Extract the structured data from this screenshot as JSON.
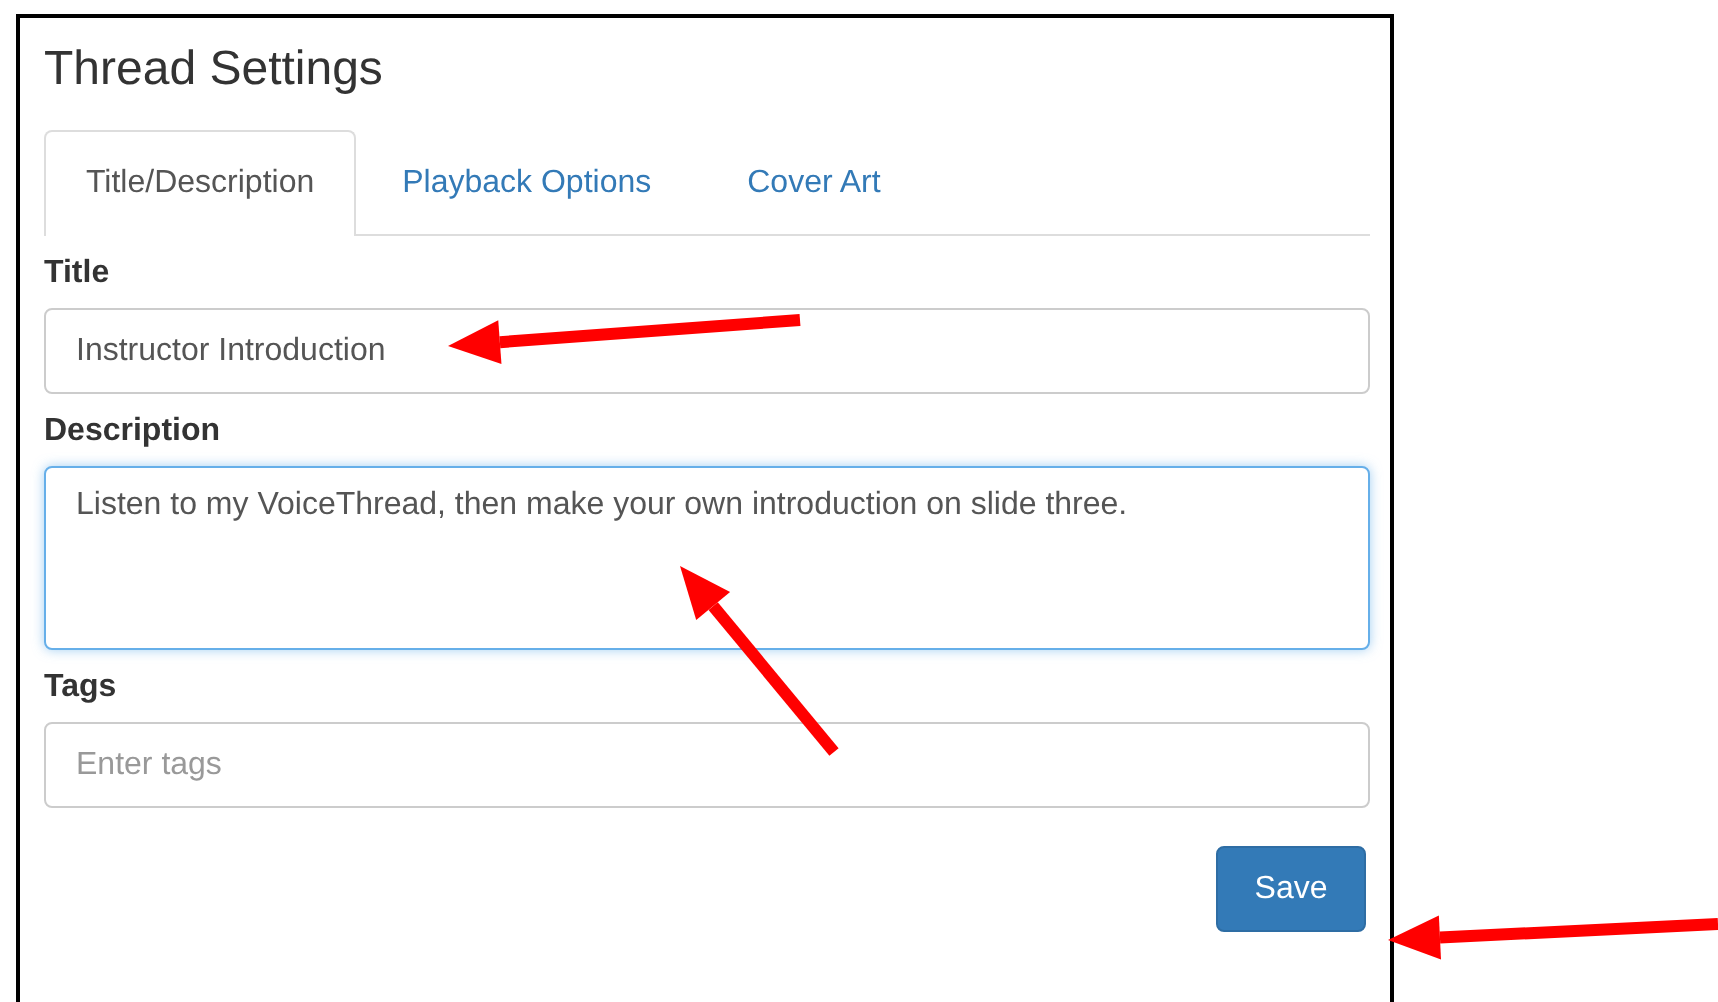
{
  "heading": "Thread Settings",
  "tabs": [
    {
      "label": "Title/Description",
      "selected": true
    },
    {
      "label": "Playback Options",
      "selected": false
    },
    {
      "label": "Cover Art",
      "selected": false
    }
  ],
  "fields": [
    {
      "kind": "input",
      "label": "Title",
      "value": "Instructor Introduction",
      "focused": false
    },
    {
      "kind": "textarea",
      "label": "Description",
      "value": "Listen to my VoiceThread, then make your own introduction on slide three.",
      "focused": true
    },
    {
      "kind": "input",
      "label": "Tags",
      "placeholder": "Enter tags",
      "focused": false
    }
  ],
  "save_button": "Save"
}
